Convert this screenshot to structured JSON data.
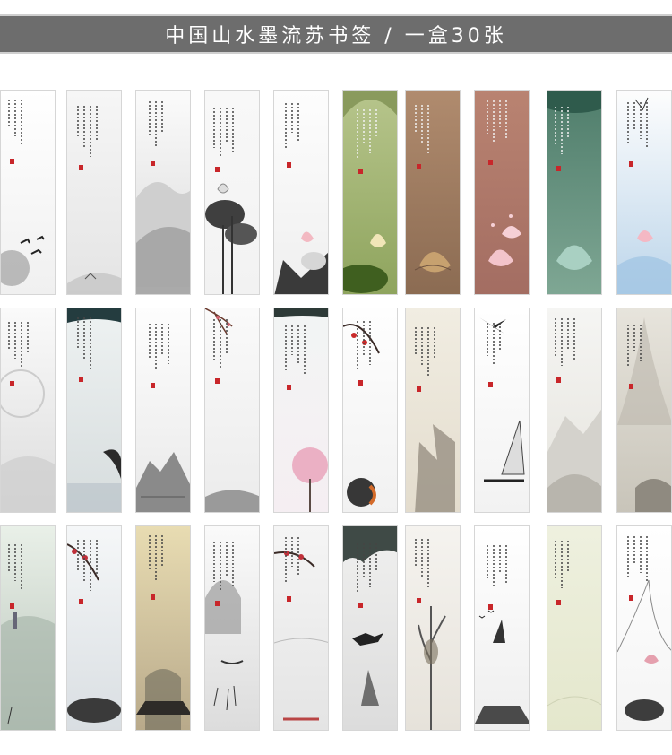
{
  "banner": {
    "title": "中国山水墨流苏书签 / 一盒30张"
  },
  "product": {
    "box_count": 30,
    "rows": [
      [
        "plain-crane",
        "ink-mist",
        "mountains",
        "lotus-ink",
        "lotus-rock",
        "green-lotus",
        "brown-lotus",
        "peach-lotus",
        "teal-lotus",
        "blue-blossom"
      ],
      [
        "circle-mist",
        "boat-wave",
        "landscape",
        "plum-cliff",
        "pink-tree",
        "red-plum",
        "cliff",
        "eagle-sail",
        "pale-mountain",
        "grey-pine"
      ],
      [
        "lake-boat",
        "plum-lotus",
        "gold-lotus",
        "fisherman",
        "plum-mist",
        "pine-horse",
        "tree",
        "birds-sail",
        "pale-green",
        "lotus-sketch"
      ]
    ]
  },
  "colors": {
    "banner": "#6d6d6d",
    "ink": "#333333",
    "seal": "#c8262a"
  }
}
